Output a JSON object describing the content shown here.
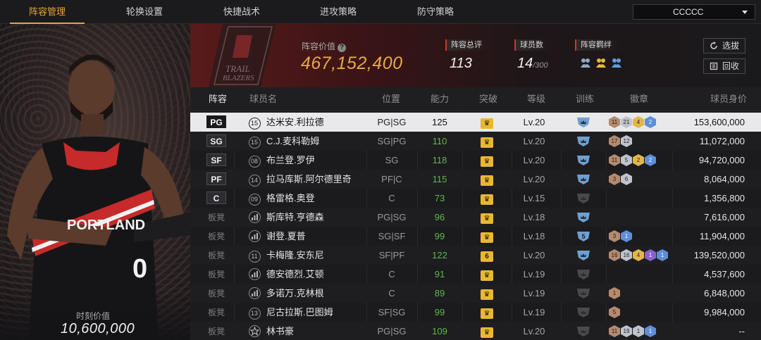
{
  "tabs": [
    "阵容管理",
    "轮换设置",
    "快捷战术",
    "进攻策略",
    "防守策略"
  ],
  "active_tab": 0,
  "team_select": {
    "value": "CCCCC"
  },
  "hero": {
    "value_label": "时刻价值",
    "value": "10,600,000",
    "jersey_text": "PORTLAND",
    "jersey_number": "0"
  },
  "summary": {
    "lineup_value_label": "阵容价值",
    "lineup_value": "467,152,400",
    "rating_label": "阵容总评",
    "rating": "113",
    "players_label": "球员数",
    "players": "14",
    "players_max": "/300",
    "bond_label": "阵容羁绊",
    "buttons": {
      "pick": "选拔",
      "recycle": "回收"
    }
  },
  "logo_text": [
    "TRAIL",
    "BLAZERS"
  ],
  "headers": {
    "lineup": "阵容",
    "name": "球员名",
    "position": "位置",
    "ability": "能力",
    "breakthrough": "突破",
    "level": "等级",
    "training": "训练",
    "badges": "徽章",
    "salary": "球员身价"
  },
  "rows": [
    {
      "slot": "PG",
      "num": "15",
      "name": "达米安.利拉德",
      "pos": "PG|SG",
      "ovr": "125",
      "brk": "",
      "lv": "Lv.20",
      "train": "crown",
      "badges": [
        [
          "b",
          "11"
        ],
        [
          "s",
          "21"
        ],
        [
          "g",
          "4"
        ],
        [
          "u",
          "2"
        ]
      ],
      "salary": "153,600,000",
      "selected": true
    },
    {
      "slot": "SG",
      "num": "15",
      "name": "C.J.麦科勒姆",
      "pos": "SG|PG",
      "ovr": "110",
      "brk": "",
      "lv": "Lv.20",
      "train": "crown",
      "badges": [
        [
          "b",
          "17"
        ],
        [
          "s",
          "12"
        ]
      ],
      "salary": "11,072,000"
    },
    {
      "slot": "SF",
      "num": "08",
      "name": "布兰登.罗伊",
      "pos": "SG",
      "ovr": "118",
      "brk": "",
      "lv": "Lv.20",
      "train": "crown",
      "badges": [
        [
          "b",
          "11"
        ],
        [
          "s",
          "5"
        ],
        [
          "g",
          "2"
        ],
        [
          "u",
          "2"
        ]
      ],
      "salary": "94,720,000"
    },
    {
      "slot": "PF",
      "num": "14",
      "name": "拉马库斯.阿尔德里奇",
      "pos": "PF|C",
      "ovr": "115",
      "brk": "",
      "lv": "Lv.20",
      "train": "crown",
      "badges": [
        [
          "b",
          "3"
        ],
        [
          "s",
          "6"
        ]
      ],
      "salary": "8,064,000"
    },
    {
      "slot": "C",
      "num": "09",
      "name": "格雷格.奥登",
      "pos": "C",
      "ovr": "73",
      "brk": "",
      "lv": "Lv.15",
      "train": "grey",
      "badges": [],
      "salary": "1,356,800"
    },
    {
      "slot": "板凳",
      "num": "bars",
      "name": "斯库特.亨德森",
      "pos": "PG|SG",
      "ovr": "96",
      "brk": "",
      "lv": "Lv.18",
      "train": "crown",
      "badges": [],
      "salary": "7,616,000"
    },
    {
      "slot": "板凳",
      "num": "bars",
      "name": "谢登.夏普",
      "pos": "SG|SF",
      "ovr": "99",
      "brk": "",
      "lv": "Lv.18",
      "train": "5",
      "badges": [
        [
          "b",
          "3"
        ],
        [
          "u",
          "1"
        ]
      ],
      "salary": "11,904,000"
    },
    {
      "slot": "板凳",
      "num": "11",
      "name": "卡梅隆.安东尼",
      "pos": "SF|PF",
      "ovr": "122",
      "brk": "6",
      "lv": "Lv.20",
      "train": "crown",
      "badges": [
        [
          "b",
          "16"
        ],
        [
          "s",
          "16"
        ],
        [
          "g",
          "4"
        ],
        [
          "p",
          "1"
        ],
        [
          "u",
          "1"
        ]
      ],
      "salary": "139,520,000"
    },
    {
      "slot": "板凳",
      "num": "bars",
      "name": "德安德烈.艾顿",
      "pos": "C",
      "ovr": "91",
      "brk": "",
      "lv": "Lv.19",
      "train": "grey",
      "badges": [],
      "salary": "4,537,600"
    },
    {
      "slot": "板凳",
      "num": "bars",
      "name": "多诺万.克林根",
      "pos": "C",
      "ovr": "89",
      "brk": "",
      "lv": "Lv.19",
      "train": "grey",
      "badges": [
        [
          "b",
          "1"
        ]
      ],
      "salary": "6,848,000"
    },
    {
      "slot": "板凳",
      "num": "13",
      "name": "尼古拉斯.巴图姆",
      "pos": "SF|SG",
      "ovr": "99",
      "brk": "",
      "lv": "Lv.19",
      "train": "grey",
      "badges": [
        [
          "b",
          "5"
        ]
      ],
      "salary": "9,984,000"
    },
    {
      "slot": "板凳",
      "num": "star",
      "name": "林书豪",
      "pos": "PG|SG",
      "ovr": "109",
      "brk": "",
      "lv": "Lv.20",
      "train": "grey",
      "badges": [
        [
          "b",
          "11"
        ],
        [
          "s",
          "19"
        ],
        [
          "s",
          "1"
        ],
        [
          "u",
          "1"
        ]
      ],
      "salary": "--"
    }
  ],
  "colors": {
    "accent": "#e8a33c",
    "ovr_green": "#5fb84a",
    "gold": "#e8b734",
    "selected_row": "#e9e9eb"
  }
}
